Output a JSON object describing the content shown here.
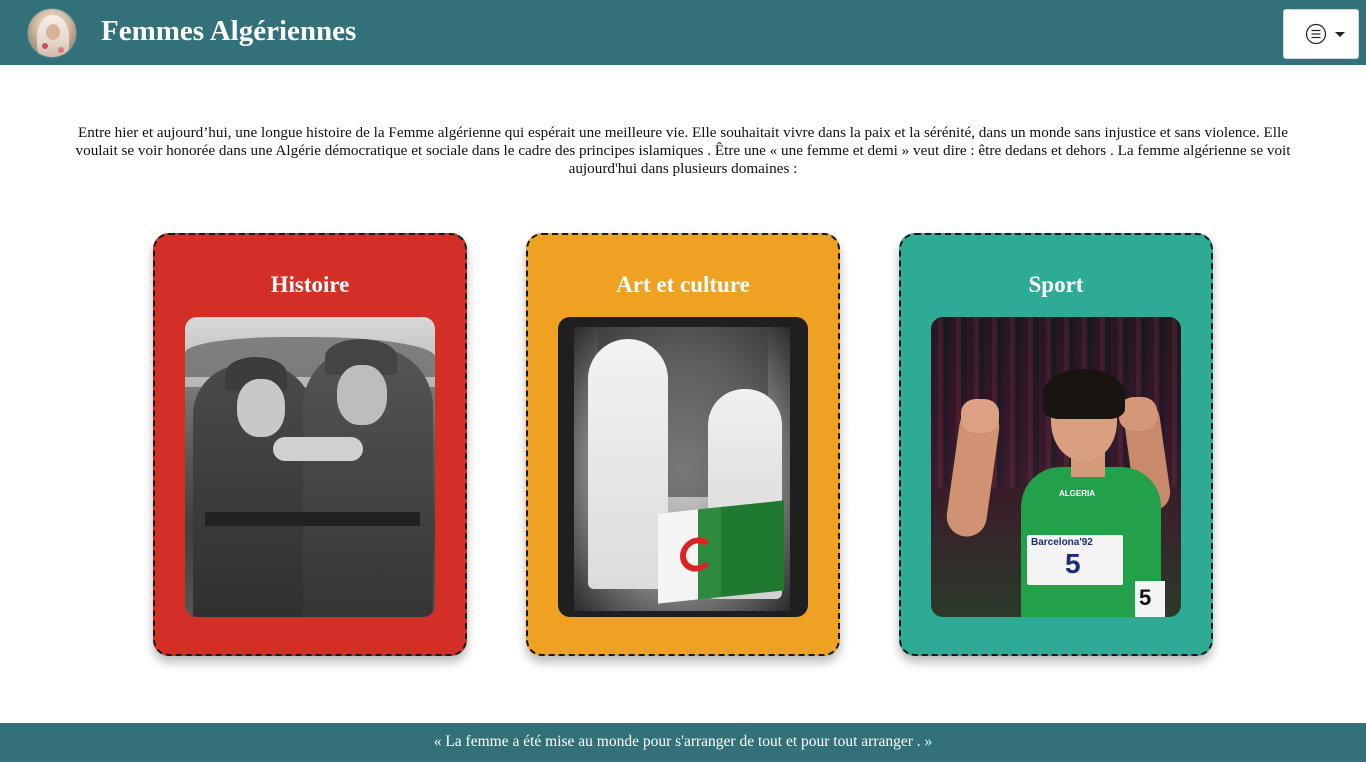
{
  "header": {
    "title": "Femmes Algériennes",
    "logo_icon": "veiled-woman-portrait",
    "menu_icon": "list-circle-icon",
    "background_color": "#33717a"
  },
  "intro": {
    "text": "Entre hier et aujourd’hui, une longue histoire de la Femme algérienne qui espérait une meilleure vie. Elle souhaitait vivre dans la paix et la sérénité, dans un monde sans injustice et sans violence. Elle voulait se voir honorée dans une Algérie démocratique et sociale dans le cadre des principes islamiques . Être une « une femme et demi » veut dire : être dedans et dehors . La femme algérienne se voit aujourd'hui dans plusieurs domaines :"
  },
  "cards": [
    {
      "title": "Histoire",
      "color": "#d42f26",
      "image": "women-soldiers-photo"
    },
    {
      "title": "Art et culture",
      "color": "#efa122",
      "image": "veiled-women-flag-photo"
    },
    {
      "title": "Sport",
      "color": "#2dab94",
      "image": "athlete-celebrating-photo",
      "image_texts": {
        "jersey": "ALGERIA",
        "bib": "Barcelona'92",
        "number": "5"
      }
    }
  ],
  "footer": {
    "quote": "« La femme a été mise au monde pour s'arranger de tout et pour tout arranger . »"
  }
}
